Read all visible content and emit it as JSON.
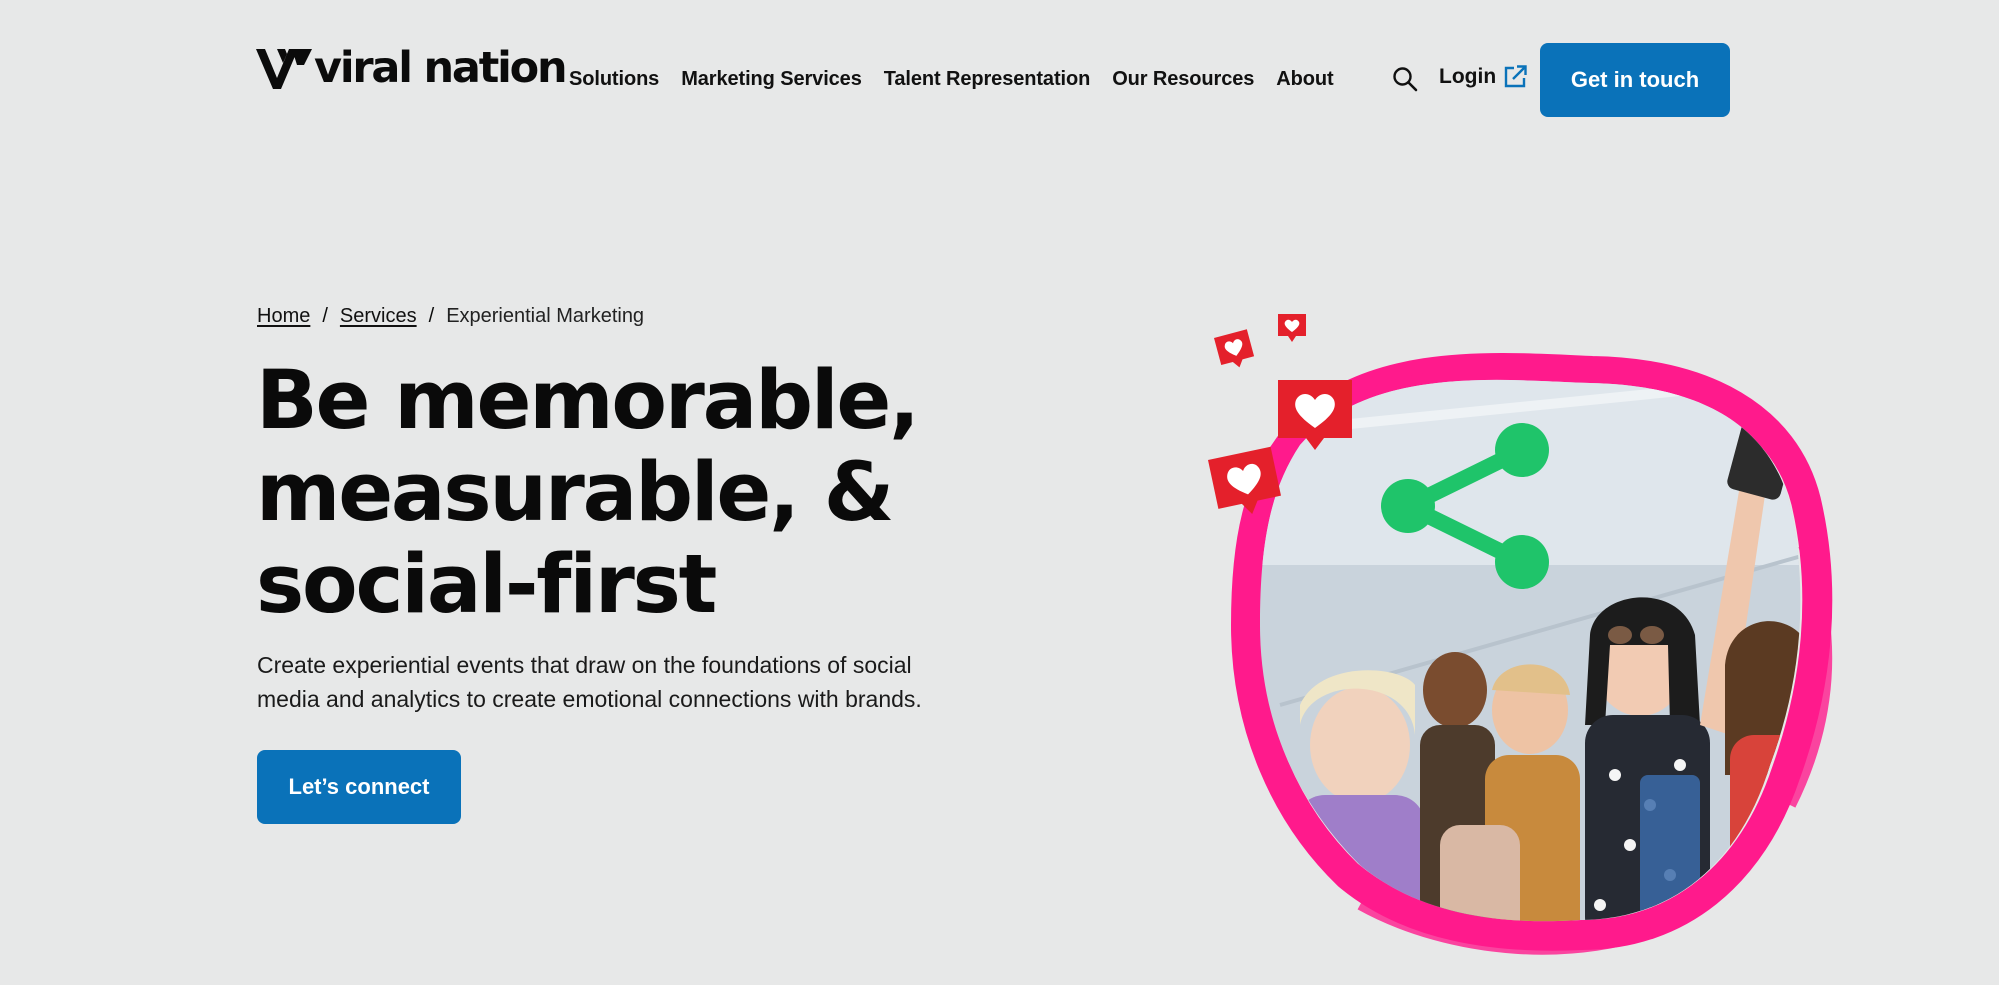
{
  "brand": {
    "name": "viral nation"
  },
  "nav": {
    "items": [
      {
        "label": "Solutions"
      },
      {
        "label": "Marketing Services"
      },
      {
        "label": "Talent Representation"
      },
      {
        "label": "Our Resources"
      },
      {
        "label": "About"
      }
    ],
    "search_icon": "search-icon",
    "login_label": "Login",
    "login_icon": "external-link-icon",
    "cta_label": "Get in touch"
  },
  "breadcrumb": {
    "home": "Home",
    "separator": "/",
    "services": "Services",
    "current": "Experiential Marketing"
  },
  "hero": {
    "headline_lines": [
      "Be memorable,",
      "measurable, &",
      "social-first"
    ],
    "subtext_lines": [
      "Create experiential events that draw on the foundations of social",
      "media and analytics to create emotional connections with brands."
    ],
    "cta_label": "Let’s connect",
    "image_icons": [
      "heart-notification-icon",
      "share-icon"
    ]
  },
  "colors": {
    "background": "#e7e8e8",
    "accent": "#0a72b9",
    "heart_red": "#e4202b",
    "share_green": "#1fc46a",
    "brush_pink": "#ff1a8c"
  }
}
